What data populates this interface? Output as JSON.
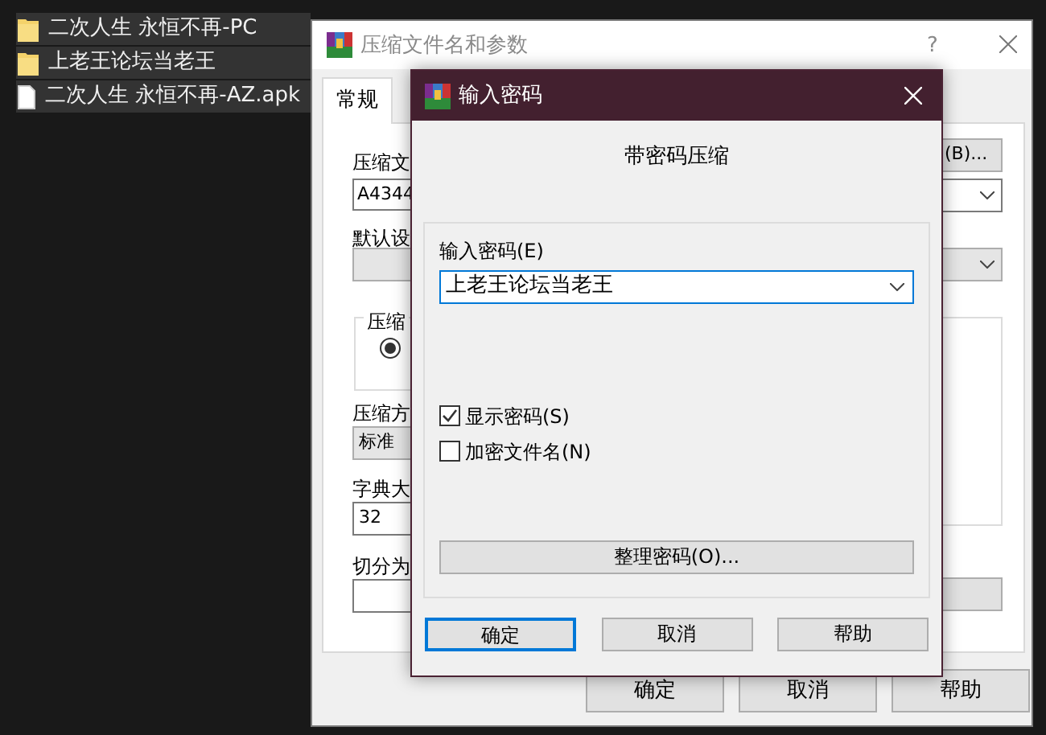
{
  "explorer": {
    "items": [
      {
        "kind": "folder",
        "name": "二次人生 永恒不再-PC",
        "selected": true
      },
      {
        "kind": "folder",
        "name": "上老王论坛当老王",
        "selected": true
      },
      {
        "kind": "file",
        "name": "二次人生 永恒不再-AZ.apk",
        "selected": true
      }
    ]
  },
  "archive_dialog": {
    "title": "压缩文件名和参数",
    "help": "?",
    "tabs": [
      {
        "label": "常规",
        "selected": true
      }
    ],
    "archive_name": {
      "label": "压缩文",
      "value": "A4344"
    },
    "browse_button": "(B)...",
    "profile_label": "默认设",
    "format_group": {
      "label": "压缩",
      "radio_selected": true
    },
    "method": {
      "label": "压缩方",
      "value": "标准"
    },
    "dictionary": {
      "label": "字典大",
      "value": "32"
    },
    "split_label": "切分为",
    "buttons": [
      "确定",
      "取消",
      "帮助"
    ]
  },
  "password_dialog": {
    "title": "输入密码",
    "heading": "带密码压缩",
    "password_label": "输入密码(E)",
    "password_value": "上老王论坛当老王",
    "options": [
      {
        "label": "显示密码(S)",
        "checked": true
      },
      {
        "label": "加密文件名(N)",
        "checked": false
      }
    ],
    "organize_button": "整理密码(O)...",
    "buttons": [
      {
        "label": "确定",
        "default": true
      },
      {
        "label": "取消",
        "default": false
      },
      {
        "label": "帮助",
        "default": false
      }
    ]
  }
}
